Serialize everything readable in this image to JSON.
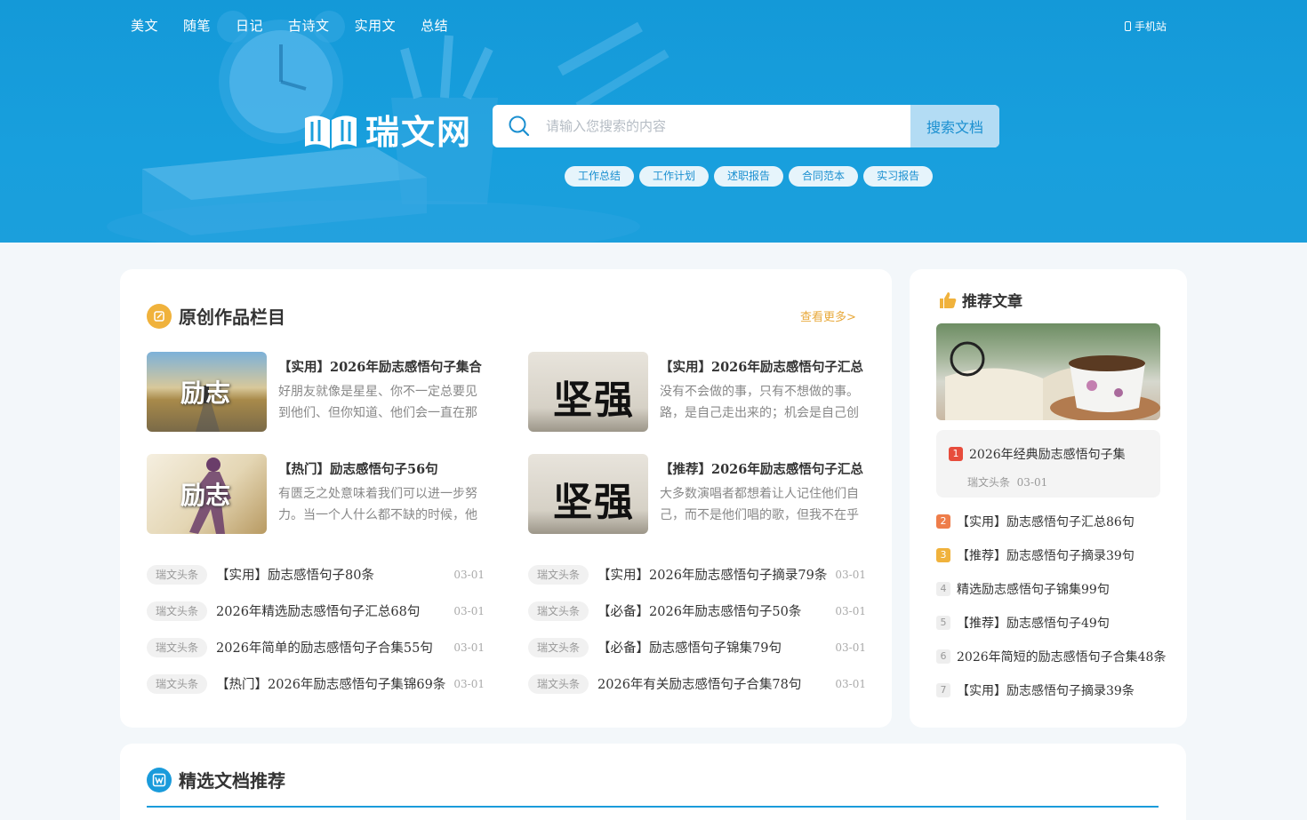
{
  "nav": {
    "items": [
      "美文",
      "随笔",
      "日记",
      "古诗文",
      "实用文",
      "总结"
    ],
    "mobile": "手机站"
  },
  "logo": {
    "text": "瑞文网"
  },
  "search": {
    "placeholder": "请输入您搜索的内容",
    "button": "搜索文档",
    "tags": [
      "工作总结",
      "工作计划",
      "述职报告",
      "合同范本",
      "实习报告"
    ]
  },
  "original": {
    "title": "原创作品栏目",
    "more": "查看更多>",
    "featured": [
      {
        "title": "【实用】2026年励志感悟句子集合",
        "desc": "好朋友就像是星星、你不一定总要见到他们、但你知道、他们会一直在那",
        "thumb": "励志"
      },
      {
        "title": "【实用】2026年励志感悟句子汇总",
        "desc": "没有不会做的事，只有不想做的事。路，是自己走出来的；机会是自己创",
        "thumb": "坚强"
      },
      {
        "title": "【热门】励志感悟句子56句",
        "desc": "有匮乏之处意味着我们可以进一步努力。当一个人什么都不缺的时候，他",
        "thumb": "励志"
      },
      {
        "title": "【推荐】2026年励志感悟句子汇总",
        "desc": "大多数演唱者都想着让人记住他们自己，而不是他们唱的歌，但我不在乎",
        "thumb": "坚强"
      }
    ],
    "list_left": [
      {
        "tag": "瑞文头条",
        "title": "【实用】励志感悟句子80条",
        "date": "03-01"
      },
      {
        "tag": "瑞文头条",
        "title": "2026年精选励志感悟句子汇总68句",
        "date": "03-01"
      },
      {
        "tag": "瑞文头条",
        "title": "2026年简单的励志感悟句子合集55句",
        "date": "03-01"
      },
      {
        "tag": "瑞文头条",
        "title": "【热门】2026年励志感悟句子集锦69条",
        "date": "03-01"
      }
    ],
    "list_right": [
      {
        "tag": "瑞文头条",
        "title": "【实用】2026年励志感悟句子摘录79条",
        "date": "03-01"
      },
      {
        "tag": "瑞文头条",
        "title": "【必备】2026年励志感悟句子50条",
        "date": "03-01"
      },
      {
        "tag": "瑞文头条",
        "title": "【必备】励志感悟句子锦集79句",
        "date": "03-01"
      },
      {
        "tag": "瑞文头条",
        "title": "2026年有关励志感悟句子合集78句",
        "date": "03-01"
      }
    ]
  },
  "recommend": {
    "title": "推荐文章",
    "highlight": {
      "num": "1",
      "title": "2026年经典励志感悟句子集",
      "source": "瑞文头条",
      "date": "03-01"
    },
    "items": [
      {
        "num": "2",
        "title": "【实用】励志感悟句子汇总86句"
      },
      {
        "num": "3",
        "title": "【推荐】励志感悟句子摘录39句"
      },
      {
        "num": "4",
        "title": "精选励志感悟句子锦集99句"
      },
      {
        "num": "5",
        "title": "【推荐】励志感悟句子49句"
      },
      {
        "num": "6",
        "title": "2026年简短的励志感悟句子合集48条"
      },
      {
        "num": "7",
        "title": "【实用】励志感悟句子摘录39条"
      }
    ]
  },
  "selected": {
    "title": "精选文档推荐"
  },
  "colors": {
    "hero": "#1499d8",
    "accent": "#e8a93b",
    "num1": "#e74c3c",
    "num2": "#ee7d4a",
    "num3": "#f0b23c"
  }
}
